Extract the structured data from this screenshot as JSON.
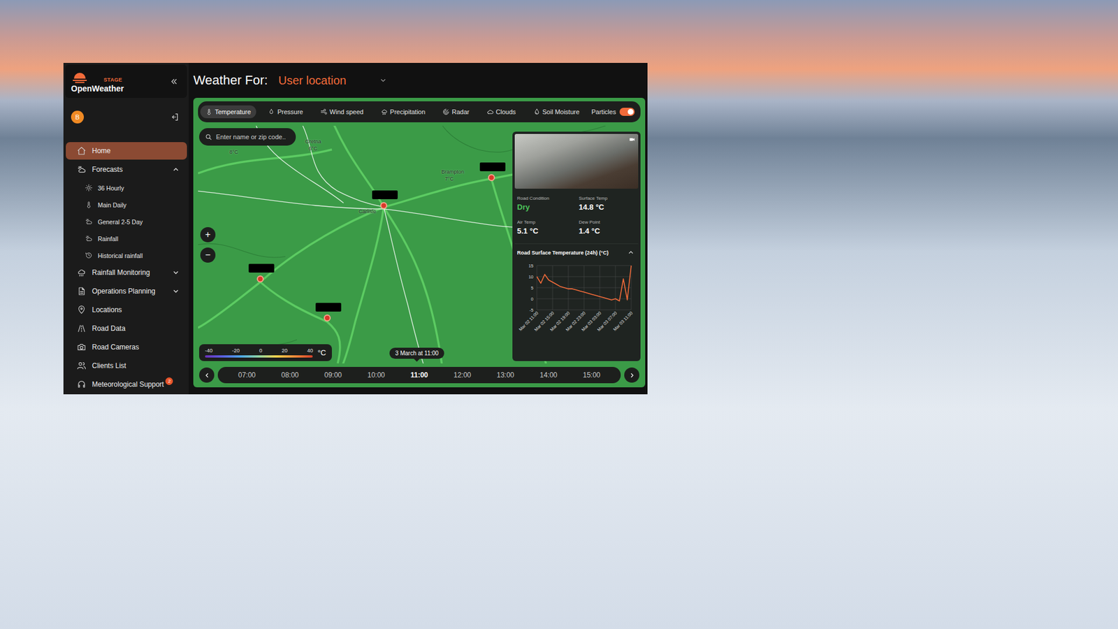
{
  "app": {
    "env": "STAGE",
    "brand": "OpenWeather"
  },
  "user": {
    "initial": "B"
  },
  "sidebar": {
    "items": [
      {
        "label": "Home",
        "selected": true,
        "expandable": false,
        "expanded": false,
        "badge": "",
        "children": []
      },
      {
        "label": "Forecasts",
        "selected": false,
        "expandable": true,
        "expanded": true,
        "badge": "",
        "children": [
          {
            "label": "36 Hourly",
            "selected": false
          },
          {
            "label": "Main Daily",
            "selected": false
          },
          {
            "label": "General 2-5 Day",
            "selected": false
          },
          {
            "label": "Rainfall",
            "selected": false
          },
          {
            "label": "Historical rainfall",
            "selected": false
          }
        ]
      },
      {
        "label": "Rainfall Monitoring",
        "selected": false,
        "expandable": true,
        "expanded": false,
        "badge": "",
        "children": []
      },
      {
        "label": "Operations Planning",
        "selected": false,
        "expandable": true,
        "expanded": false,
        "badge": "",
        "children": []
      },
      {
        "label": "Locations",
        "selected": false,
        "expandable": false,
        "expanded": false,
        "badge": "",
        "children": []
      },
      {
        "label": "Road Data",
        "selected": false,
        "expandable": false,
        "expanded": false,
        "badge": "",
        "children": []
      },
      {
        "label": "Road Cameras",
        "selected": false,
        "expandable": false,
        "expanded": false,
        "badge": "",
        "children": []
      },
      {
        "label": "Clients List",
        "selected": false,
        "expandable": false,
        "expanded": false,
        "badge": "",
        "children": []
      },
      {
        "label": "Meteorological Support",
        "selected": false,
        "expandable": false,
        "expanded": false,
        "badge": "2",
        "children": []
      }
    ]
  },
  "header": {
    "title": "Weather For:",
    "location": "User location"
  },
  "layers": {
    "tabs": [
      {
        "label": "Temperature",
        "selected": true
      },
      {
        "label": "Pressure",
        "selected": false
      },
      {
        "label": "Wind speed",
        "selected": false
      },
      {
        "label": "Precipitation",
        "selected": false
      },
      {
        "label": "Radar",
        "selected": false
      },
      {
        "label": "Clouds",
        "selected": false
      },
      {
        "label": "Soil Moisture",
        "selected": false
      }
    ],
    "particles": {
      "label": "Particles",
      "on": true
    }
  },
  "search": {
    "placeholder": "Enter name or zip code.."
  },
  "zoom": {
    "in": "+",
    "out": "−"
  },
  "map": {
    "labels": [
      "Gretna",
      "6°C",
      "Brampton",
      "7°C",
      "Carlisle",
      "8°C"
    ]
  },
  "legend": {
    "ticks": [
      "-40",
      "-20",
      "0",
      "20",
      "40"
    ],
    "unit": "°C"
  },
  "time_tooltip": "3 March at 11:00",
  "timeline": {
    "hours": [
      {
        "label": "07:00",
        "selected": false
      },
      {
        "label": "08:00",
        "selected": false
      },
      {
        "label": "09:00",
        "selected": false
      },
      {
        "label": "10:00",
        "selected": false
      },
      {
        "label": "11:00",
        "selected": true
      },
      {
        "label": "12:00",
        "selected": false
      },
      {
        "label": "13:00",
        "selected": false
      },
      {
        "label": "14:00",
        "selected": false
      },
      {
        "label": "15:00",
        "selected": false
      }
    ]
  },
  "card": {
    "fields": [
      {
        "label": "Road Condition",
        "value": "Dry",
        "color": "#4cc35a"
      },
      {
        "label": "Surface Temp",
        "value": "14.8 °C",
        "color": "#ffffff"
      },
      {
        "label": "Air Temp",
        "value": "5.1 °C",
        "color": "#ffffff"
      },
      {
        "label": "Dew Point",
        "value": "1.4 °C",
        "color": "#ffffff"
      }
    ],
    "chart": {
      "title": "Road Surface Temperature (24h) (°C)",
      "expanded": true,
      "y_ticks": [
        "15",
        "10",
        "5",
        "0",
        "-5"
      ],
      "x_ticks": [
        "Mar 02 11:00",
        "Mar 02 15:00",
        "Mar 02 19:00",
        "Mar 02 23:00",
        "Mar 03 03:00",
        "Mar 03 07:00",
        "Mar 03 11:00"
      ],
      "series": [
        {
          "values": [
            10,
            7,
            11,
            8.5,
            7.5,
            6.5,
            5.5,
            5,
            4.5,
            4.5,
            4,
            3.5,
            3,
            2.5,
            2,
            1.5,
            1,
            0.5,
            0,
            -0.5,
            0,
            -1,
            9,
            -0.5,
            15
          ]
        }
      ]
    }
  }
}
